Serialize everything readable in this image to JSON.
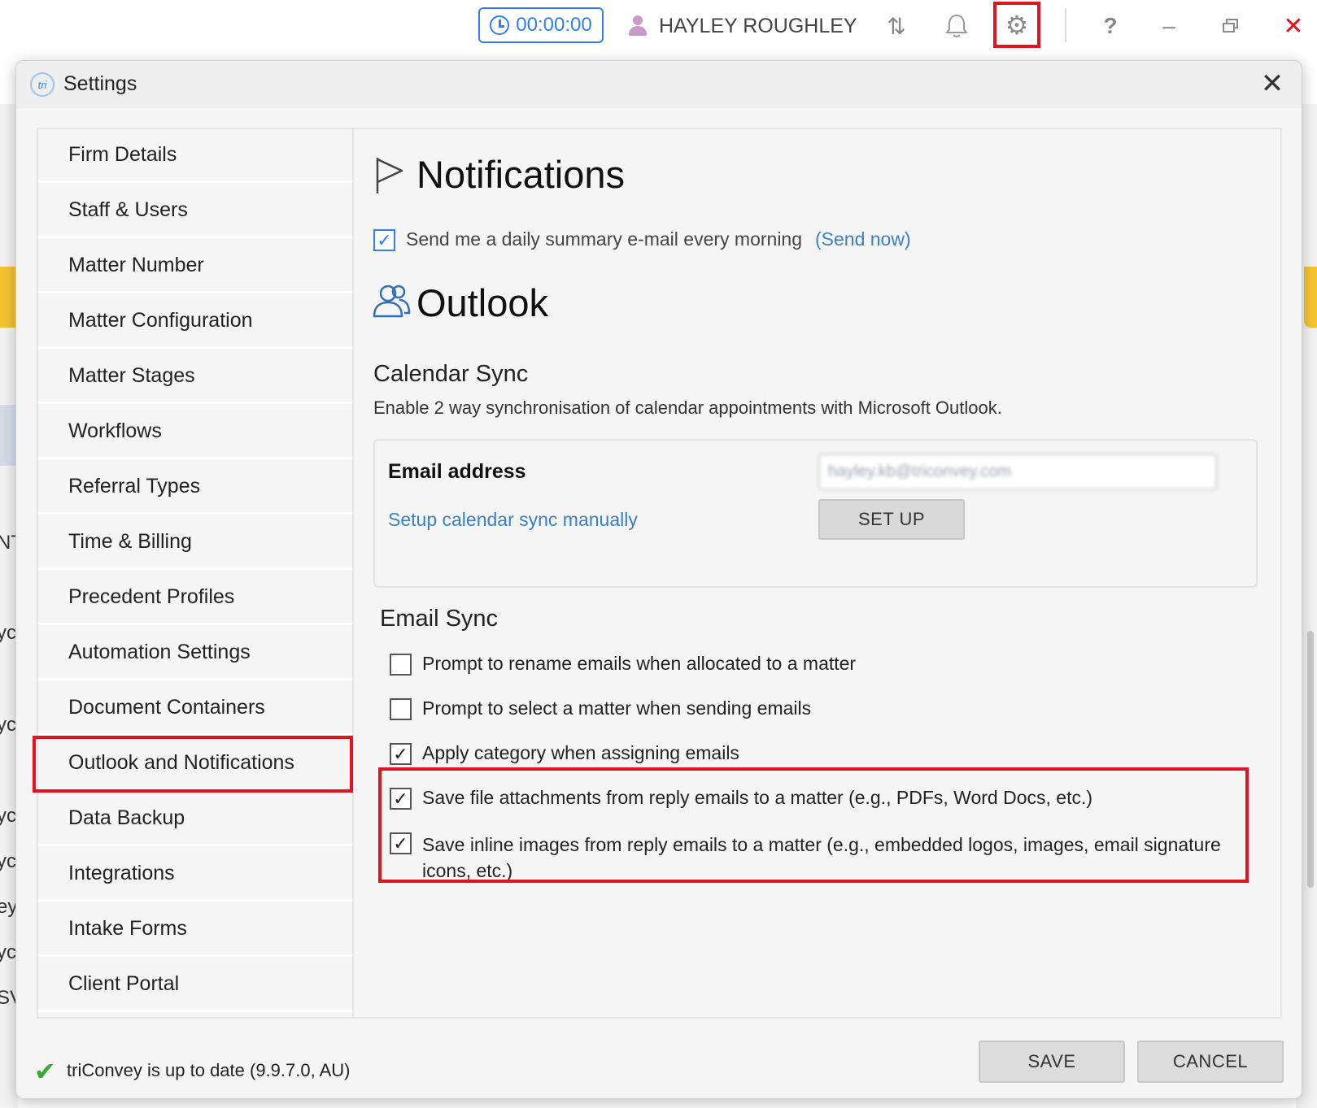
{
  "topbar": {
    "timer": "00:00:00",
    "user_name": "HAYLEY ROUGHLEY",
    "sync_glyph": "⇅",
    "bell_glyph": "🔔",
    "gear_glyph": "⚙",
    "help_glyph": "?",
    "minimize_glyph": "–",
    "restore_glyph": "🗗",
    "close_glyph": "✕",
    "accent_color": "#2f80ed",
    "highlight_color": "#e0141e"
  },
  "background": {
    "edge_text": [
      "NT",
      "yc",
      "yc",
      "yc",
      "yc",
      "ey",
      "yc",
      "SV"
    ]
  },
  "dialog": {
    "logo_text": "tri",
    "title": "Settings",
    "close_glyph": "✕"
  },
  "sidebar": {
    "items": [
      {
        "label": "Firm Details"
      },
      {
        "label": "Staff & Users"
      },
      {
        "label": "Matter Number"
      },
      {
        "label": "Matter Configuration"
      },
      {
        "label": "Matter Stages"
      },
      {
        "label": "Workflows"
      },
      {
        "label": "Referral Types"
      },
      {
        "label": "Time & Billing"
      },
      {
        "label": "Precedent Profiles"
      },
      {
        "label": "Automation Settings"
      },
      {
        "label": "Document Containers"
      },
      {
        "label": "Outlook and Notifications",
        "active": true
      },
      {
        "label": "Data Backup"
      },
      {
        "label": "Integrations"
      },
      {
        "label": "Intake Forms"
      },
      {
        "label": "Client Portal"
      }
    ]
  },
  "notifications": {
    "title": "Notifications",
    "daily_summary_label": "Send me a daily summary e-mail every morning",
    "daily_summary_checked": true,
    "send_now_link": "(Send now)"
  },
  "outlook": {
    "title": "Outlook",
    "calendar_sync": {
      "title": "Calendar Sync",
      "description": "Enable 2 way synchronisation of calendar appointments with Microsoft Outlook.",
      "email_label": "Email address",
      "email_value": "hayley.kb@triconvey.com",
      "manual_link": "Setup calendar sync manually",
      "setup_button": "SET UP"
    },
    "email_sync": {
      "title": "Email Sync",
      "options": [
        {
          "label": "Prompt to rename emails when allocated to a matter",
          "checked": false
        },
        {
          "label": "Prompt to select a matter when sending emails",
          "checked": false
        },
        {
          "label": "Apply category when assigning emails",
          "checked": true
        },
        {
          "label": "Save file attachments from reply emails to a matter (e.g., PDFs, Word Docs, etc.)",
          "checked": true
        },
        {
          "label": "Save inline images from reply emails to a matter (e.g., embedded logos, images, email signature icons, etc.)",
          "checked": true
        }
      ]
    }
  },
  "footer": {
    "status_check_glyph": "✔",
    "status_text": "triConvey is up to date (9.9.7.0, AU)",
    "save_button": "SAVE",
    "cancel_button": "CANCEL"
  }
}
